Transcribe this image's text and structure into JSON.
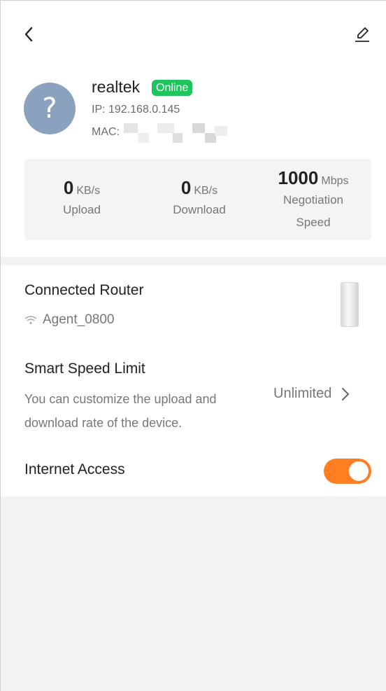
{
  "device": {
    "name": "realtek",
    "status": "Online",
    "ip": "IP: 192.168.0.145",
    "mac_label": "MAC:",
    "avatar_glyph": "?"
  },
  "stats": {
    "upload": {
      "value": "0",
      "unit": "KB/s",
      "label": "Upload"
    },
    "download": {
      "value": "0",
      "unit": "KB/s",
      "label": "Download"
    },
    "negotiation": {
      "value": "1000",
      "unit": "Mbps",
      "label_line1": "Negotiation",
      "label_line2": "Speed"
    }
  },
  "connected_router": {
    "title": "Connected Router",
    "ssid": "Agent_0800",
    "ssid_icon": "wifi-icon"
  },
  "smart_speed_limit": {
    "title": "Smart Speed Limit",
    "description": "You can customize the upload and download rate of the device.",
    "value": "Unlimited"
  },
  "internet_access": {
    "title": "Internet Access",
    "enabled": true
  },
  "colors": {
    "accent": "#ff7e21",
    "online": "#1fc55c",
    "avatar": "#8aa2bd"
  },
  "icons": {
    "back": "chevron-left-icon",
    "edit": "pencil-icon",
    "more": "chevron-right-icon"
  }
}
